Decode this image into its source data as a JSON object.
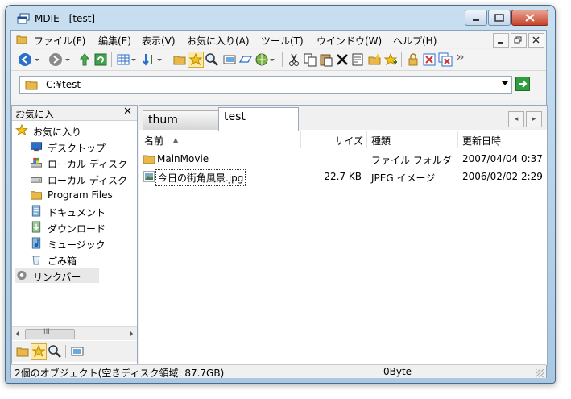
{
  "window": {
    "title": "MDIE - [test]"
  },
  "menu": {
    "items": [
      "ファイル(F)",
      "編集(E)",
      "表示(V)",
      "お気に入り(A)",
      "ツール(T)",
      "ウインドウ(W)",
      "ヘルプ(H)"
    ]
  },
  "address": {
    "path": "C:¥test"
  },
  "favorites_pane": {
    "title": "お気に入",
    "close": "✕",
    "items": [
      "お気に入り",
      "デスクトップ",
      "ローカル ディスク",
      "ローカル ディスク",
      "Program Files",
      "ドキュメント",
      "ダウンロード",
      "ミュージック",
      "ごみ箱",
      "リンクバー"
    ],
    "scroll_mark": "III"
  },
  "tabs": [
    {
      "label": "thum"
    },
    {
      "label": "test"
    }
  ],
  "tab_nav": {
    "left": "◂",
    "right": "▸"
  },
  "columns": {
    "name": "名前",
    "size": "サイズ",
    "type": "種類",
    "modified": "更新日時",
    "sort_arrow": "▲"
  },
  "files": [
    {
      "name": "MainMovie",
      "size": "",
      "type": "ファイル フォルダ",
      "modified": "2007/04/04 0:37"
    },
    {
      "name": "今日の街角風景.jpg",
      "size": "22.7 KB",
      "type": "JPEG イメージ",
      "modified": "2006/02/02 2:29"
    }
  ],
  "status": {
    "left": "2個のオブジェクト(空きディスク領域: 87.7GB)",
    "right": "0Byte"
  },
  "colors": {
    "accent": "#3399ff",
    "folder": "#e8b84a",
    "close_button": "#c7432a"
  }
}
